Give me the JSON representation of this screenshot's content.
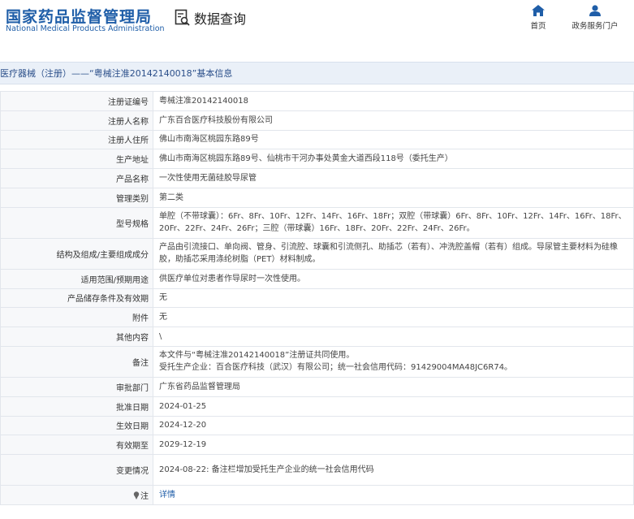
{
  "header": {
    "logo_cn": "国家药品监督管理局",
    "logo_en": "National Medical Products Administration",
    "query_label": "数据查询",
    "nav": {
      "home_label": "首页",
      "service_label": "政务服务门户"
    }
  },
  "breadcrumb": {
    "text": "医疗器械（注册）——“粤械注准20142140018”基本信息"
  },
  "details": {
    "rows": [
      {
        "label": "注册证编号",
        "value": "粤械注准20142140018"
      },
      {
        "label": "注册人名称",
        "value": "广东百合医疗科技股份有限公司"
      },
      {
        "label": "注册人住所",
        "value": "佛山市南海区桃园东路89号"
      },
      {
        "label": "生产地址",
        "value": "佛山市南海区桃园东路89号、仙桃市干河办事处黄金大道西段118号（委托生产）"
      },
      {
        "label": "产品名称",
        "value": "一次性使用无菌硅胶导尿管"
      },
      {
        "label": "管理类别",
        "value": "第二类"
      },
      {
        "label": "型号规格",
        "value": "单腔（不带球囊）：6Fr、8Fr、10Fr、12Fr、14Fr、16Fr、18Fr；双腔（带球囊）6Fr、8Fr、10Fr、12Fr、14Fr、16Fr、18Fr、20Fr、22Fr、24Fr、26Fr；三腔（带球囊）16Fr、18Fr、20Fr、22Fr、24Fr、26Fr。"
      },
      {
        "label": "结构及组成/主要组成成分",
        "value": "产品由引流接口、单向阀、管身、引流腔、球囊和引流侧孔、助插芯（若有）、冲洗腔盖帽（若有）组成。导尿管主要材料为硅橡胶，助插芯采用涤纶树脂（PET）材料制成。"
      },
      {
        "label": "适用范围/预期用途",
        "value": "供医疗单位对患者作导尿时一次性使用。"
      },
      {
        "label": "产品储存条件及有效期",
        "value": "无"
      },
      {
        "label": "附件",
        "value": "无"
      },
      {
        "label": "其他内容",
        "value": "\\"
      },
      {
        "label": "备注",
        "line1": "本文件与“粤械注准20142140018”注册证共同使用。",
        "line2": "受托生产企业：百合医疗科技（武汉）有限公司；统一社会信用代码：91429004MA48JC6R74。"
      },
      {
        "label": "审批部门",
        "value": "广东省药品监督管理局"
      },
      {
        "label": "批准日期",
        "value": "2024-01-25"
      },
      {
        "label": "生效日期",
        "value": "2024-12-20"
      },
      {
        "label": "有效期至",
        "value": "2029-12-19"
      },
      {
        "label": "变更情况",
        "value": "2024-08-22: 备注栏增加受托生产企业的统一社会信用代码"
      },
      {
        "label": "注",
        "value": "详情"
      }
    ]
  },
  "colors": {
    "brand": "#1f5ea8",
    "breadcrumb_bg": "#eaf0f8",
    "label_bg": "#f7f8fa"
  },
  "icons": {
    "query": "search-document-icon",
    "home": "home-icon",
    "service": "user-icon",
    "note": "pin-icon"
  }
}
